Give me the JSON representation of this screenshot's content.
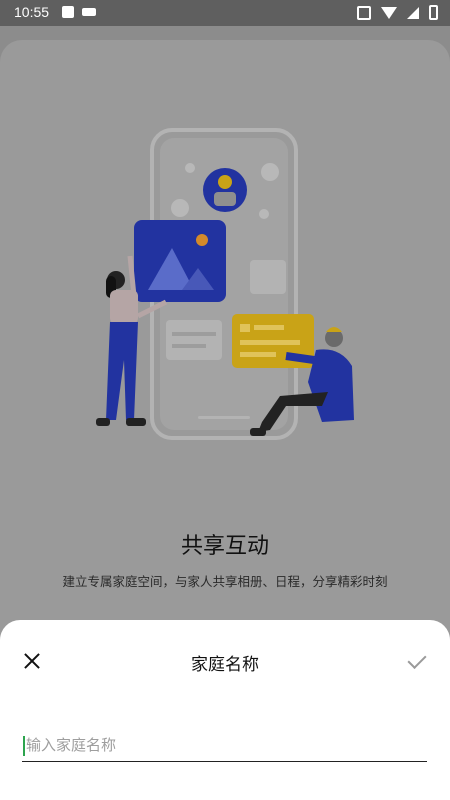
{
  "status_bar": {
    "time": "10:55"
  },
  "onboarding": {
    "title": "共享互动",
    "subtitle": "建立专属家庭空间，与家人共享相册、日程，分享精彩时刻"
  },
  "sheet": {
    "title": "家庭名称",
    "input_placeholder": "输入家庭名称",
    "input_value": ""
  },
  "colors": {
    "illustration_blue": "#2233a0",
    "illustration_yellow": "#c9a317",
    "cursor_green": "#2da44e"
  }
}
